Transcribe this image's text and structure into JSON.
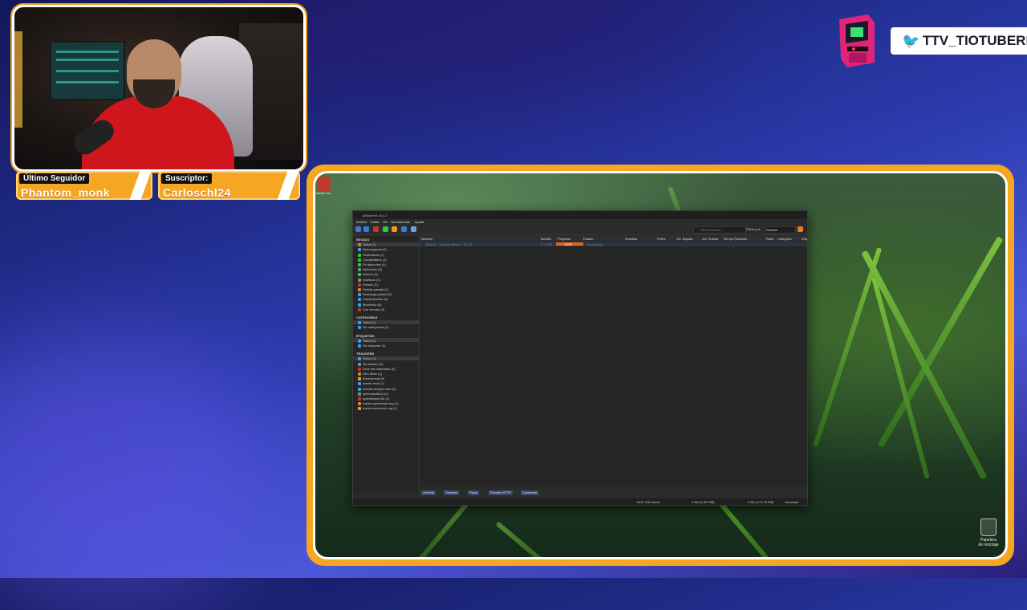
{
  "overlay": {
    "follower_label": "Último Seguidor",
    "follower_name": "Phantom_monk",
    "subscriber_label": "Suscriptor:",
    "subscriber_name": "Carloschl24",
    "twitter_handle": "TTV_TIOTUBERIA",
    "accent_color": "#f5a623"
  },
  "desktop": {
    "recycle_bin_label": "Papelera de reciclaje",
    "desktop_icon_label": "Adobe Ed..."
  },
  "qbittorrent": {
    "title": "qBittorrent v5.1.2",
    "menu": [
      "Archivo",
      "Editar",
      "Ver",
      "Herramientas",
      "Ayuda"
    ],
    "filter_placeholder": "Filtrar torrents...",
    "filter_by_label": "Filtrar por:",
    "filter_by_value": "Nombre",
    "sidebar": {
      "estado_header": "ESTADO",
      "estado_items": [
        "Todos (1)",
        "Descargando (0)",
        "Sembrando (1)",
        "Completados (1)",
        "En ejecución (1)",
        "Detenidos (0)",
        "Activos (0)",
        "Inactivos (1)",
        "Parado (1)",
        "Subida parada (1)",
        "Descarga parada (0)",
        "Comprobando (0)",
        "Moviendo (0)",
        "Con errores (0)"
      ],
      "categorias_header": "CATEGORÍAS",
      "categorias_items": [
        "Todos (1)",
        "Sin categorizar (1)"
      ],
      "etiquetas_header": "ETIQUETAS",
      "etiquetas_items": [
        "Todos (1)",
        "Sin etiquetar (1)"
      ],
      "trackers_header": "TRACKERS",
      "trackers_items": [
        "Todos (1)",
        "Sin tracker (0)",
        "Error del rastreador (0)",
        "Otro aviso (1)",
        "Advertencia (0)",
        "anidex.moe (1)",
        "exodus.desync.com (1)",
        "open.stealth.si (1)",
        "opentracker.i2p (1)",
        "tracker.opentrackr.org (1)",
        "tracker.torrent.eu.org (1)"
      ]
    },
    "columns": [
      "Nombre",
      "Tamaño",
      "Progreso",
      "Estado",
      "Semillas",
      "Pares",
      "Vel. Bajada",
      "Vel. Subida",
      "Tiempo Restante",
      "Ratio",
      "Categoría",
      "Etiq"
    ],
    "row": {
      "name": "[Batch] - Cowboy Bebop - 01-26",
      "size": "17.5 GiB",
      "progress": "100%",
      "progress_fraction": 1.0,
      "state": "Sembrando"
    },
    "bottom_tabs": [
      "General",
      "Trackers",
      "Pares",
      "Fuentes HTTP",
      "Contenido"
    ],
    "status": {
      "dht": "DHT: 296 nodos",
      "down": "0 B/s (2,89 GiB)",
      "up": "0 B/s (179,78 KiB)",
      "speed_button": "Velocidad"
    }
  }
}
